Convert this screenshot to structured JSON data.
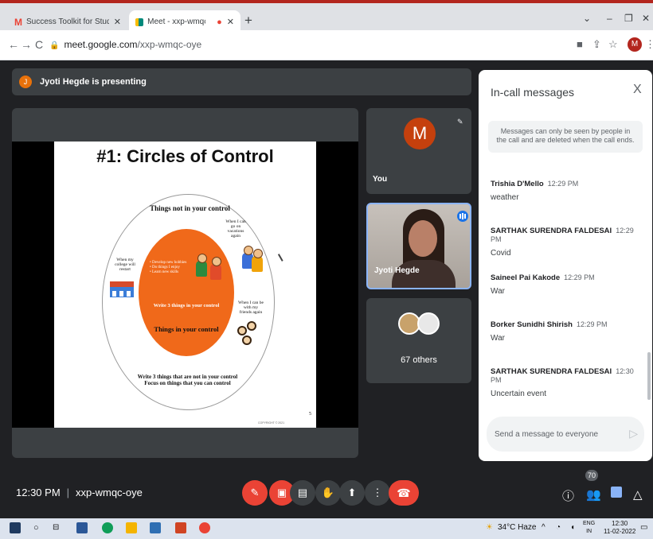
{
  "browser": {
    "tabs": [
      {
        "title": "Success Toolkit for Students - ma",
        "active": false
      },
      {
        "title": "Meet - xxp-wmqc-oye",
        "active": true
      }
    ],
    "address_host": "meet.google.com",
    "address_path": "/xxp-wmqc-oye",
    "profile_initial": "M"
  },
  "meet": {
    "presenting_avatar": "J",
    "presenting_text": "Jyoti Hegde is presenting",
    "slide": {
      "title": "#1: Circles of Control",
      "outer_label": "Things not in your control",
      "note_vacations": "When I can go on vacations again",
      "note_college": "When my college will restart",
      "note_friends": "When I can be with my friends again",
      "bullet_1": "• Develop new hobbies",
      "bullet_2": "• Do things I enjoy",
      "bullet_3": "• Learn new skills",
      "inner_write": "Write 3 things in your control",
      "inner_label": "Things in your control",
      "bottom_line_1": "Write 3 things that are not in your control",
      "bottom_line_2": "Focus on things that you can control",
      "page_number": "5",
      "copyright": "COPYRIGHT © 2021"
    },
    "tiles": {
      "you_initial": "M",
      "you_label": "You",
      "presenter_label": "Jyoti Hegde",
      "others_label": "67 others"
    },
    "bottom_bar": {
      "time": "12:30 PM",
      "meeting_code": "xxp-wmqc-oye",
      "people_count": "70"
    }
  },
  "chat": {
    "title": "In-call messages",
    "notice": "Messages can only be seen by people in the call and are deleted when the call ends.",
    "messages": [
      {
        "sender": "Trishia D'Mello",
        "time": "12:29 PM",
        "text": "weather"
      },
      {
        "sender": "SARTHAK SURENDRA FALDESAI",
        "time": "12:29 PM",
        "text": "Covid"
      },
      {
        "sender": "Saineel Pai Kakode",
        "time": "12:29 PM",
        "text": "War"
      },
      {
        "sender": "Borker Sunidhi Shirish",
        "time": "12:29 PM",
        "text": "War"
      },
      {
        "sender": "SARTHAK SURENDRA FALDESAI",
        "time": "12:30 PM",
        "text": "Uncertain event"
      }
    ],
    "input_placeholder": "Send a message to everyone"
  },
  "taskbar": {
    "weather": "34°C Haze",
    "lang_1": "ENG",
    "lang_2": "IN",
    "clock_time": "12:30",
    "clock_date": "11-02-2022"
  },
  "colors": {
    "accent_red": "#ea4335",
    "meet_bg": "#202124",
    "chat_blue": "#8ab4f8"
  }
}
